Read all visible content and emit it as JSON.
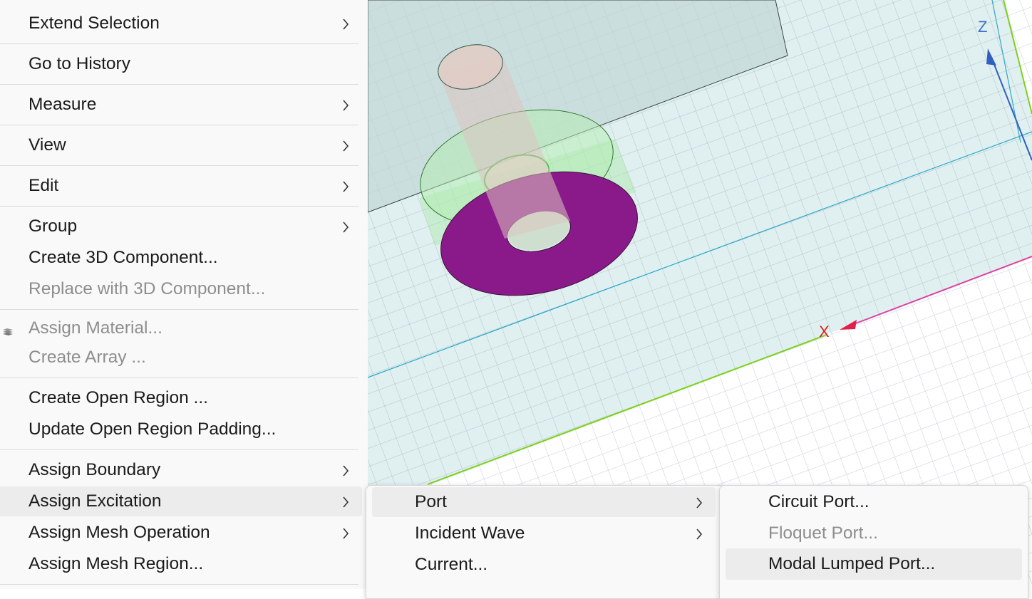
{
  "colors": {
    "menu_bg": "#f9f9f9",
    "highlight": "#ececec",
    "text": "#1a1a1a",
    "disabled_text": "#8e8e8e",
    "purple_face": "#8a1a8a",
    "x_axis": "#e03080",
    "z_axis": "#3060c0",
    "green_edge": "#80d020",
    "grid": "#c8ced8"
  },
  "viewport": {
    "axis_x_label": "X",
    "axis_z_label": "Z"
  },
  "main_menu": {
    "items": [
      {
        "label": "Extend Selection",
        "submenu": true,
        "enabled": true
      },
      {
        "label": "Go to History",
        "submenu": false,
        "enabled": true
      },
      {
        "label": "Measure",
        "submenu": true,
        "enabled": true
      },
      {
        "label": "View",
        "submenu": true,
        "enabled": true
      },
      {
        "label": "Edit",
        "submenu": true,
        "enabled": true
      },
      {
        "label": "Group",
        "submenu": true,
        "enabled": true
      },
      {
        "label": "Create 3D Component...",
        "submenu": false,
        "enabled": true
      },
      {
        "label": "Replace with 3D Component...",
        "submenu": false,
        "enabled": false
      },
      {
        "label": "Assign Material...",
        "submenu": false,
        "enabled": false,
        "icon": "material-icon"
      },
      {
        "label": "Create Array ...",
        "submenu": false,
        "enabled": false
      },
      {
        "label": "Create Open Region ...",
        "submenu": false,
        "enabled": true
      },
      {
        "label": "Update Open Region Padding...",
        "submenu": false,
        "enabled": true
      },
      {
        "label": "Assign Boundary",
        "submenu": true,
        "enabled": true
      },
      {
        "label": "Assign Excitation",
        "submenu": true,
        "enabled": true,
        "highlighted": true
      },
      {
        "label": "Assign Mesh Operation",
        "submenu": true,
        "enabled": true
      },
      {
        "label": "Assign Mesh Region...",
        "submenu": false,
        "enabled": true
      }
    ]
  },
  "excitation_menu": {
    "items": [
      {
        "label": "Port",
        "submenu": true,
        "enabled": true,
        "highlighted": true
      },
      {
        "label": "Incident Wave",
        "submenu": true,
        "enabled": true
      },
      {
        "label": "Current...",
        "submenu": false,
        "enabled": true
      }
    ]
  },
  "port_menu": {
    "items": [
      {
        "label": "Circuit Port...",
        "enabled": true
      },
      {
        "label": "Floquet Port...",
        "enabled": false
      },
      {
        "label": "Modal Lumped Port...",
        "enabled": true,
        "highlighted": true
      }
    ]
  }
}
